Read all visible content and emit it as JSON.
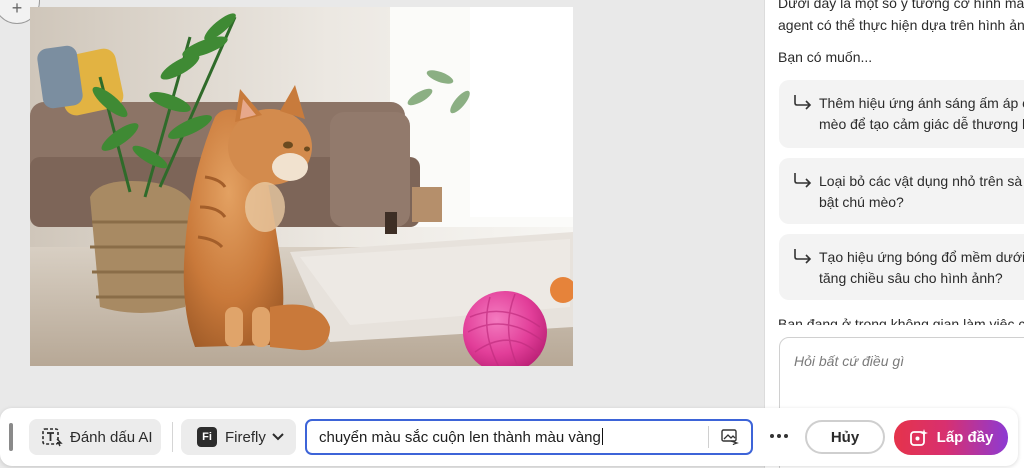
{
  "canvas": {
    "zoom_icon": "plus-icon",
    "image_alt": "orange-cat-with-pink-yarn-ball"
  },
  "panel": {
    "intro_line1": "Dưới đây là một số ý tưởng cơ hình mà",
    "intro_line2": "agent có thể thực hiện dựa trên hình ản",
    "question": "Bạn có muốn...",
    "suggestions": [
      {
        "line1": "Thêm hiệu ứng ánh sáng ấm áp c",
        "line2": "mèo để tạo cảm giác dễ thương h"
      },
      {
        "line1": "Loại bỏ các vật dụng nhỏ trên sà",
        "line2": "bật chú mèo?"
      },
      {
        "line1": "Tạo hiệu ứng bóng đổ mềm dưới",
        "line2": "tăng chiều sâu cho hình ảnh?"
      }
    ],
    "workspace_note": "Bạn đang ở trong không gian làm việc c",
    "chat_placeholder": "Hỏi bất cứ điều gì"
  },
  "toolbar": {
    "ai_mark_label": "Đánh dấu AI",
    "model_logo": "Fi",
    "model_label": "Firefly",
    "prompt_value": "chuyển màu sắc cuộn len thành màu vàng",
    "cancel_label": "Hủy",
    "fill_label": "Lấp đầy"
  },
  "colors": {
    "accent_blue": "#3d64d8",
    "fill_gradient_start": "#e5334b",
    "fill_gradient_end": "#8d3ad3",
    "yarn_pink": "#e8479f"
  }
}
